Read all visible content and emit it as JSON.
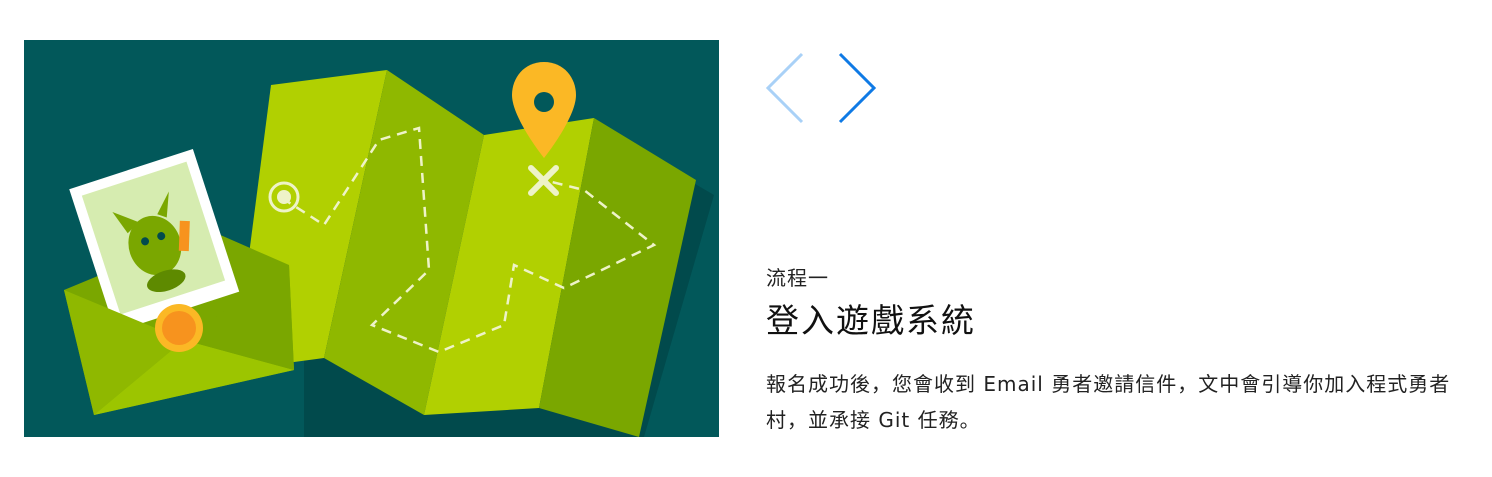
{
  "illustration": {
    "background_color": "#02585a",
    "map_colors": [
      "#b1d001",
      "#8fb800",
      "#7aa700"
    ],
    "pin_color": "#fbb825",
    "seal_color": "#f7931e"
  },
  "carousel": {
    "prev_icon": "chevron-left",
    "next_icon": "chevron-right",
    "prev_color": "#a9d1f7",
    "next_color": "#0f7ae5"
  },
  "step": {
    "label": "流程一",
    "title": "登入遊戲系統",
    "description": "報名成功後，您會收到 Email 勇者邀請信件，文中會引導你加入程式勇者村，並承接 Git 任務。"
  }
}
